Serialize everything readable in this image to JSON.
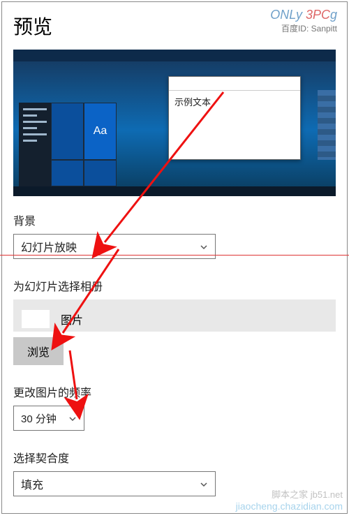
{
  "title": "预览",
  "watermark": {
    "line1": "ONLy",
    "line2": "3PC",
    "baidu": "百度ID: Sanpitt"
  },
  "previewTile": "Aa",
  "sampleWindow": {
    "text": "示例文本"
  },
  "background": {
    "label": "背景",
    "value": "幻灯片放映"
  },
  "album": {
    "label": "为幻灯片选择相册",
    "item": "图片",
    "browse": "浏览"
  },
  "frequency": {
    "label": "更改图片的频率",
    "value": "30 分钟"
  },
  "fit": {
    "label": "选择契合度",
    "value": "填充"
  },
  "footer": {
    "a": "脚本之家  jb51.net",
    "b": "jiaocheng.chazidian.com"
  }
}
